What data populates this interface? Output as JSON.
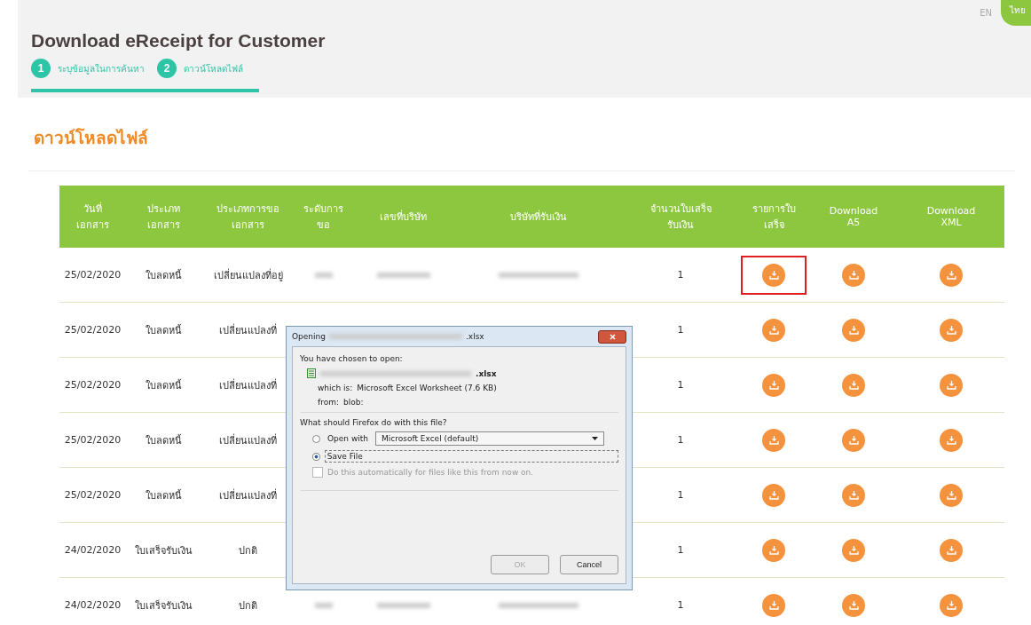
{
  "languages": [
    {
      "label": "EN",
      "selected": false
    },
    {
      "label": "ไทย",
      "selected": true
    }
  ],
  "title": "Download eReceipt for Customer",
  "steps": [
    {
      "number": "1",
      "label": "ระบุข้อมูลในการค้นหา"
    },
    {
      "number": "2",
      "label": "ดาวน์โหลดไฟล์"
    }
  ],
  "section_title": "ดาวน์โหลดไฟล์",
  "table": {
    "columns": [
      [
        "วันที่",
        "เอกสาร"
      ],
      [
        "ประเภท",
        "เอกสาร"
      ],
      [
        "ประเภทการขอ",
        "เอกสาร"
      ],
      [
        "ระดับการ",
        "ขอ"
      ],
      [
        "เลขที่บริษัท"
      ],
      [
        "บริษัทที่รับเงิน"
      ],
      [
        "จำนวนใบเสร็จ",
        "รับเงิน"
      ],
      [
        "รายการใบ",
        "เสร็จ"
      ],
      [
        "Download",
        "A5"
      ],
      [
        "Download",
        "XML"
      ]
    ],
    "rows": [
      {
        "date": "25/02/2020",
        "doc_type": "ใบลดหนี้",
        "request_type": "เปลี่ยนแปลงที่อยู่",
        "details_blurred": true,
        "count": "1",
        "downloads": [
          {
            "highlighted": true
          },
          {
            "highlighted": false
          },
          {
            "highlighted": false
          }
        ]
      },
      {
        "date": "25/02/2020",
        "doc_type": "ใบลดหนี้",
        "request_type": "เปลี่ยนแปลงที่",
        "count": "1",
        "downloads": [
          {
            "highlighted": false
          },
          {
            "highlighted": false
          },
          {
            "highlighted": false
          }
        ]
      },
      {
        "date": "25/02/2020",
        "doc_type": "ใบลดหนี้",
        "request_type": "เปลี่ยนแปลงที่",
        "count": "1",
        "downloads": [
          {
            "highlighted": false
          },
          {
            "highlighted": false
          },
          {
            "highlighted": false
          }
        ]
      },
      {
        "date": "25/02/2020",
        "doc_type": "ใบลดหนี้",
        "request_type": "เปลี่ยนแปลงที่",
        "count": "1",
        "downloads": [
          {
            "highlighted": false
          },
          {
            "highlighted": false
          },
          {
            "highlighted": false
          }
        ]
      },
      {
        "date": "25/02/2020",
        "doc_type": "ใบลดหนี้",
        "request_type": "เปลี่ยนแปลงที่",
        "count": "1",
        "downloads": [
          {
            "highlighted": false
          },
          {
            "highlighted": false
          },
          {
            "highlighted": false
          }
        ]
      },
      {
        "date": "24/02/2020",
        "doc_type": "ใบเสร็จรับเงิน",
        "request_type": "ปกติ",
        "count": "1",
        "downloads": [
          {
            "highlighted": false
          },
          {
            "highlighted": false
          },
          {
            "highlighted": false
          }
        ]
      },
      {
        "date": "24/02/2020",
        "doc_type": "ใบเสร็จรับเงิน",
        "request_type": "ปกติ",
        "details_blurred": true,
        "count": "1",
        "downloads": [
          {
            "highlighted": false
          },
          {
            "highlighted": false
          },
          {
            "highlighted": false
          }
        ]
      }
    ]
  },
  "dialog": {
    "title_prefix": "Opening",
    "title_suffix": ".xlsx",
    "intro": "You have chosen to open:",
    "file_suffix": ".xlsx",
    "which_is_label": "which is:",
    "which_is": "Microsoft Excel Worksheet (7.6 KB)",
    "from_label": "from:",
    "from": "blob:",
    "question": "What should Firefox do with this file?",
    "options": [
      {
        "label": "Open with",
        "selected": false,
        "app": "Microsoft Excel (default)"
      },
      {
        "label": "Save File",
        "selected": true
      }
    ],
    "auto": {
      "label": "Do this automatically for files like this from now on.",
      "checked": false,
      "disabled": true
    },
    "buttons": [
      {
        "label": "OK",
        "disabled": true
      },
      {
        "label": "Cancel",
        "disabled": false
      }
    ]
  }
}
